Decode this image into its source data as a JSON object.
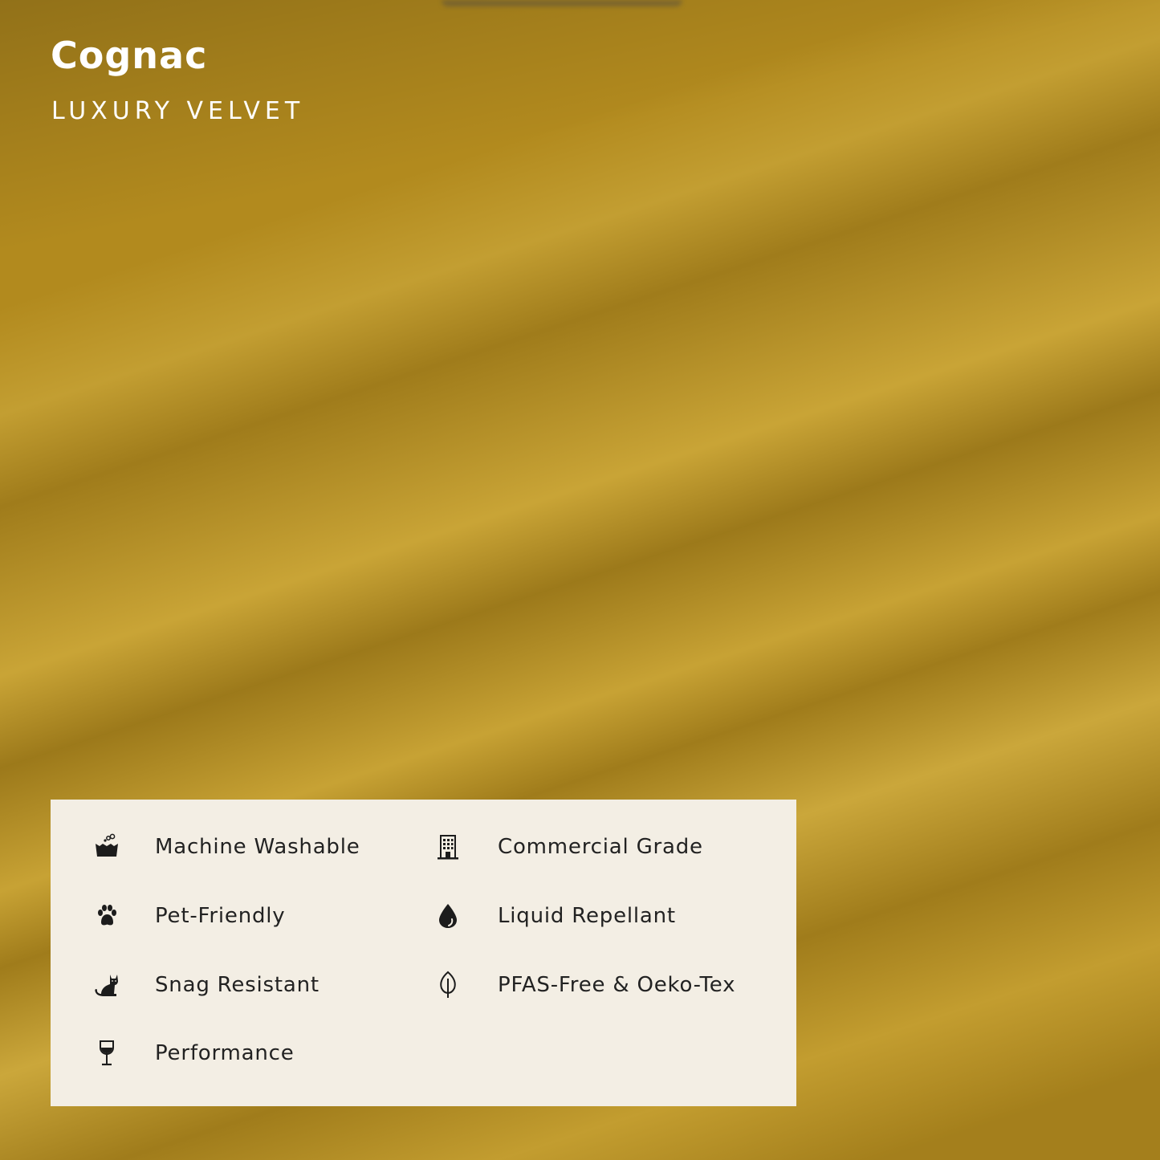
{
  "product": {
    "color_name": "Cognac",
    "material": "LUXURY VELVET"
  },
  "features": [
    {
      "label": "Machine Washable",
      "icon": "washing-tub-icon"
    },
    {
      "label": "Commercial Grade",
      "icon": "building-icon"
    },
    {
      "label": "Pet-Friendly",
      "icon": "paw-icon"
    },
    {
      "label": "Liquid Repellant",
      "icon": "water-drop-icon"
    },
    {
      "label": "Snag Resistant",
      "icon": "cat-icon"
    },
    {
      "label": "PFAS-Free & Oeko-Tex",
      "icon": "leaf-icon"
    },
    {
      "label": "Performance",
      "icon": "wine-glass-icon"
    }
  ],
  "colors": {
    "fabric": "#b28a1e",
    "panel": "#f3eee4",
    "text_dark": "#222222",
    "text_light": "#ffffff"
  }
}
